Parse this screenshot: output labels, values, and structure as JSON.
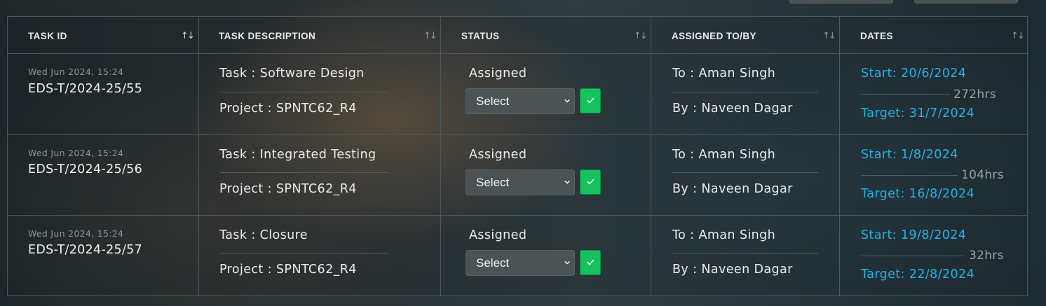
{
  "table": {
    "headers": [
      {
        "label": "TASK ID",
        "sort": "↑↓"
      },
      {
        "label": "TASK DESCRIPTION",
        "sort": "↑↓"
      },
      {
        "label": "STATUS",
        "sort": "↑↓"
      },
      {
        "label": "ASSIGNED TO/BY",
        "sort": "↑↓"
      },
      {
        "label": "DATES",
        "sort": "↑↓"
      }
    ],
    "active_sort_column": "TASK ID",
    "rows": [
      {
        "timestamp": "Wed Jun 2024, 15:24",
        "task_id": "EDS-T/2024-25/55",
        "task": "Task : Software Design",
        "project": "Project : SPNTC62_R4",
        "status": "Assigned",
        "select_value": "Select",
        "to": "To : Aman Singh",
        "by": "By : Naveen Dagar",
        "start": "Start: 20/6/2024",
        "hours": "272hrs",
        "target": "Target: 31/7/2024"
      },
      {
        "timestamp": "Wed Jun 2024, 15:24",
        "task_id": "EDS-T/2024-25/56",
        "task": "Task : Integrated Testing",
        "project": "Project : SPNTC62_R4",
        "status": "Assigned",
        "select_value": "Select",
        "to": "To : Aman Singh",
        "by": "By : Naveen Dagar",
        "start": "Start: 1/8/2024",
        "hours": "104hrs",
        "target": "Target: 16/8/2024"
      },
      {
        "timestamp": "Wed Jun 2024, 15:24",
        "task_id": "EDS-T/2024-25/57",
        "task": "Task : Closure",
        "project": "Project : SPNTC62_R4",
        "status": "Assigned",
        "select_value": "Select",
        "to": "To : Aman Singh",
        "by": "By : Naveen Dagar",
        "start": "Start: 19/8/2024",
        "hours": "32hrs",
        "target": "Target: 22/8/2024"
      }
    ]
  },
  "colors": {
    "date_accent": "#1fb2e6",
    "confirm_button": "#18c15f",
    "border": "#4c585c"
  },
  "icons": {
    "sort": "sort-arrows-icon",
    "confirm": "check-icon",
    "dropdown": "chevron-down-icon"
  }
}
